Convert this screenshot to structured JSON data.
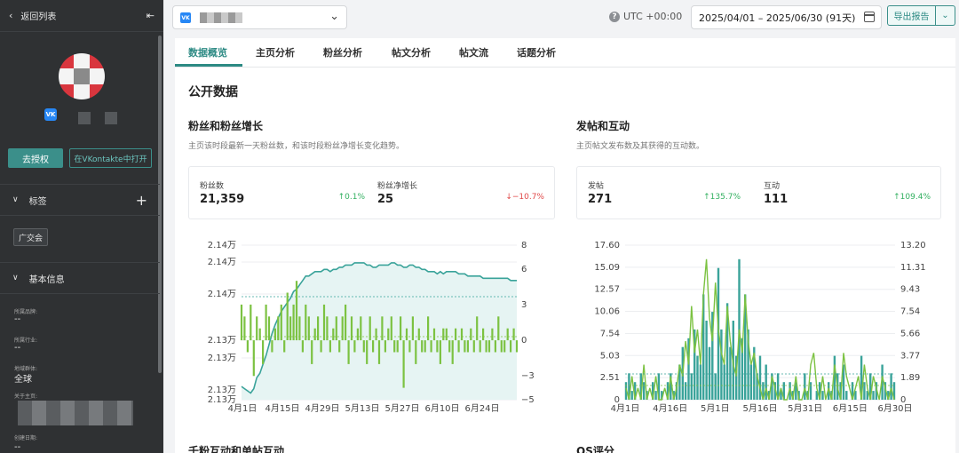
{
  "sidebar": {
    "back_label": "返回列表",
    "auth_button": "去授权",
    "open_vk_button": "在VKontakte中打开",
    "tags_title": "标签",
    "tag_item": "广交会",
    "basic_info_title": "基本信息",
    "fields": [
      {
        "label": "所属品牌:",
        "value": "--"
      },
      {
        "label": "所属行业:",
        "value": "--"
      },
      {
        "label": "地域群体:",
        "value": "全球"
      },
      {
        "label": "关于主页:",
        "value": ""
      },
      {
        "label": "创建日期:",
        "value": "--"
      }
    ]
  },
  "topbar": {
    "timezone": "UTC +00:00",
    "date_range": "2025/04/01 – 2025/06/30 (91天)",
    "export_label": "导出报告"
  },
  "tabs": [
    "数据概览",
    "主页分析",
    "粉丝分析",
    "帖文分析",
    "帖文流",
    "话题分析"
  ],
  "main": {
    "section_title": "公开数据",
    "left_panel": {
      "title": "粉丝和粉丝增长",
      "subtitle": "主页该时段最新一天粉丝数，和该时段粉丝净增长变化趋势。",
      "stats": [
        {
          "label": "粉丝数",
          "value": "21,359",
          "change": "↑0.1%",
          "dir": "up"
        },
        {
          "label": "粉丝净增长",
          "value": "25",
          "change": "↓−10.7%",
          "dir": "down"
        }
      ]
    },
    "right_panel": {
      "title": "发帖和互动",
      "subtitle": "主页帖文发布数及其获得的互动数。",
      "stats": [
        {
          "label": "发帖",
          "value": "271",
          "change": "↑135.7%",
          "dir": "up"
        },
        {
          "label": "互动",
          "value": "111",
          "change": "↑109.4%",
          "dir": "up"
        }
      ]
    },
    "bottom_left_title": "千粉互动和单帖互动",
    "bottom_right_title": "OS评分"
  },
  "colors": {
    "accent": "#2d8a84",
    "line_teal": "#3aa39a",
    "bar_green": "#7cc242",
    "up": "#32b060",
    "down": "#e04848"
  },
  "chart_data": [
    {
      "type": "line",
      "title": "粉丝和粉丝增长",
      "x_ticks": [
        "4月1日",
        "4月15日",
        "4月29日",
        "5月13日",
        "5月27日",
        "6月10日",
        "6月24日"
      ],
      "y_left_ticks": [
        "2.14万",
        "2.14万",
        "2.14万",
        "2.13万",
        "2.13万",
        "2.13万",
        "2.13万"
      ],
      "y_right_ticks": [
        "8",
        "6",
        "3",
        "0",
        "−3",
        "−5"
      ],
      "y_right_range": [
        -5,
        8
      ],
      "series": [
        {
          "kind": "area-line",
          "y_range": [
            21320,
            21390
          ],
          "values": [
            21326,
            21325,
            21324,
            21323,
            21325,
            21330,
            21332,
            21336,
            21340,
            21345,
            21350,
            21354,
            21357,
            21360,
            21362,
            21364,
            21366,
            21369,
            21370,
            21372,
            21374,
            21376,
            21376,
            21377,
            21378,
            21378,
            21378,
            21379,
            21379,
            21378,
            21379,
            21379,
            21380,
            21380,
            21381,
            21381,
            21381,
            21382,
            21382,
            21382,
            21382,
            21381,
            21381,
            21380,
            21380,
            21381,
            21381,
            21381,
            21381,
            21382,
            21382,
            21381,
            21381,
            21380,
            21380,
            21381,
            21381,
            21380,
            21380,
            21379,
            21379,
            21378,
            21378,
            21378,
            21377,
            21378,
            21377,
            21378,
            21378,
            21378,
            21378,
            21377,
            21377,
            21377,
            21376,
            21376,
            21376,
            21376,
            21376,
            21375,
            21375,
            21375,
            21375,
            21375,
            21375,
            21375,
            21375,
            21375,
            21374,
            21374,
            21374
          ]
        },
        {
          "kind": "bar",
          "values": [
            3,
            2,
            -1,
            3,
            -3,
            2,
            1,
            -2,
            3,
            2,
            -1,
            1,
            2,
            3,
            -1,
            4,
            2,
            3,
            5,
            2,
            -1,
            3,
            2,
            -2,
            1,
            2,
            -1,
            3,
            2,
            -1,
            1,
            2,
            -1,
            2,
            3,
            -2,
            2,
            -1,
            1,
            2,
            -1,
            -2,
            2,
            -1,
            1,
            -2,
            2,
            -1,
            1,
            2,
            -1,
            -1,
            2,
            -4,
            1,
            -1,
            2,
            -2,
            1,
            -1,
            -1,
            2,
            -1,
            1,
            -1,
            -2,
            1,
            1,
            -1,
            -2,
            1,
            -1,
            1,
            -1,
            -1,
            1,
            -1,
            2,
            -1,
            1,
            -1,
            -1,
            1,
            -1,
            2,
            -1,
            -1,
            1,
            -1,
            1,
            -1
          ]
        }
      ]
    },
    {
      "type": "bar",
      "title": "发帖和互动",
      "x_ticks": [
        "4月1日",
        "4月16日",
        "5月1日",
        "5月16日",
        "5月31日",
        "6月15日",
        "6月30日"
      ],
      "y_left_ticks": [
        "17.60",
        "15.09",
        "12.57",
        "10.06",
        "7.54",
        "5.03",
        "2.51",
        "0"
      ],
      "y_right_ticks": [
        "13.20",
        "11.31",
        "9.43",
        "7.54",
        "5.66",
        "3.77",
        "1.89",
        "0"
      ],
      "y_left_range": [
        0,
        17.6
      ],
      "y_right_range": [
        0,
        13.2
      ],
      "series": [
        {
          "kind": "bar",
          "values": [
            2,
            3,
            1,
            2,
            0,
            3,
            2,
            1,
            0,
            2,
            1,
            3,
            1,
            0,
            2,
            3,
            1,
            2,
            4,
            6,
            2,
            7,
            3,
            8,
            5,
            4,
            12,
            9,
            6,
            10,
            3,
            15,
            8,
            4,
            11,
            6,
            9,
            5,
            16,
            7,
            12,
            8,
            4,
            6,
            3,
            5,
            2,
            4,
            1,
            3,
            2,
            3,
            1,
            2,
            0,
            2,
            1,
            2,
            1,
            0,
            3,
            1,
            2,
            0,
            1,
            2,
            1,
            0,
            2,
            1,
            5,
            3,
            2,
            4,
            1,
            0,
            2,
            1,
            0,
            5,
            2,
            1,
            3,
            1,
            2,
            0,
            4,
            2,
            1,
            3,
            2
          ]
        },
        {
          "kind": "line",
          "values": [
            1,
            0,
            2,
            0,
            1,
            0,
            3,
            0,
            1,
            0,
            2,
            0,
            0,
            1,
            0,
            2,
            0,
            1,
            3,
            2,
            5,
            3,
            8,
            4,
            6,
            3,
            9,
            12,
            7,
            5,
            10,
            6,
            4,
            3,
            8,
            5,
            3,
            2,
            6,
            4,
            9,
            5,
            3,
            4,
            2,
            1,
            0,
            1,
            0,
            2,
            1,
            0,
            1,
            0,
            0,
            1,
            0,
            2,
            0,
            0,
            1,
            0,
            3,
            4,
            1,
            0,
            2,
            0,
            1,
            0,
            3,
            1,
            0,
            4,
            2,
            1,
            0,
            1,
            2,
            0,
            3,
            1,
            0,
            2,
            1,
            0,
            2,
            1,
            0,
            1,
            0
          ]
        }
      ]
    }
  ]
}
